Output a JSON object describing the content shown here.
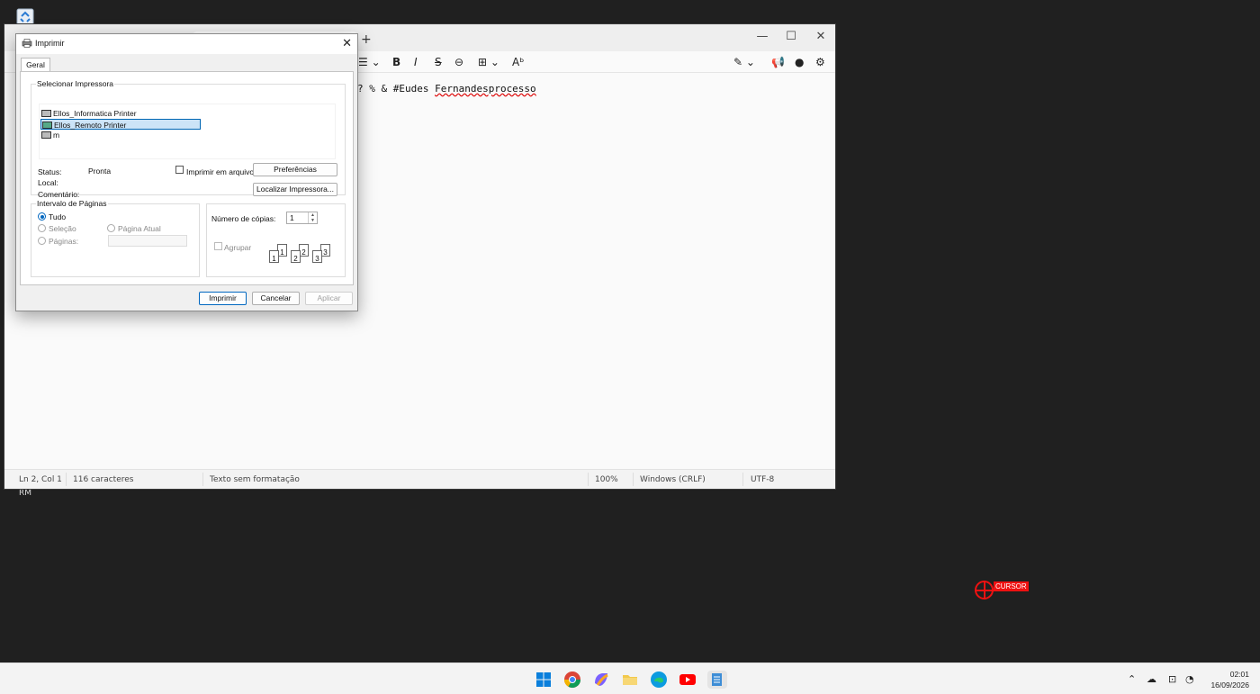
{
  "desktop": {
    "label": "RM"
  },
  "notepad": {
    "text_prefix": "? % & #Eudes ",
    "text_misspelled": "Fernandesprocesso",
    "status": {
      "position": "Ln 2, Col 1",
      "chars": "116 caracteres",
      "format": "Texto sem formatação",
      "zoom": "100%",
      "line_ending": "Windows (CRLF)",
      "encoding": "UTF-8"
    }
  },
  "dialog": {
    "title": "Imprimir",
    "tab": "Geral",
    "select_group": "Selecionar Impressora",
    "printers": [
      {
        "name": "Ellos_Informatica Printer",
        "selected": false
      },
      {
        "name": "Ellos_Remoto Printer",
        "selected": true
      },
      {
        "name": "m",
        "selected": false
      }
    ],
    "status_label": "Status:",
    "status_value": "Pronta",
    "local_label": "Local:",
    "comment_label": "Comentário:",
    "print_to_file": "Imprimir em arquivo",
    "preferences": "Preferências",
    "find_printer": "Localizar Impressora...",
    "range_group": "Intervalo de Páginas",
    "range_all": "Tudo",
    "range_selection": "Seleção",
    "range_current": "Página Atual",
    "range_pages": "Páginas:",
    "copies_label": "Número de cópias:",
    "copies_value": "1",
    "collate": "Agrupar",
    "collate_pages": [
      "1",
      "1",
      "2",
      "2",
      "3",
      "3"
    ],
    "btn_print": "Imprimir",
    "btn_cancel": "Cancelar",
    "btn_apply": "Aplicar"
  },
  "cursor": {
    "label": "CURSOR"
  },
  "taskbar": {
    "time": "02:01",
    "date": "16/09/2026",
    "apps": [
      "start-icon",
      "chrome-icon",
      "copilot-icon",
      "file-explorer-icon",
      "edge-icon",
      "youtube-icon",
      "notepad-icon"
    ]
  }
}
